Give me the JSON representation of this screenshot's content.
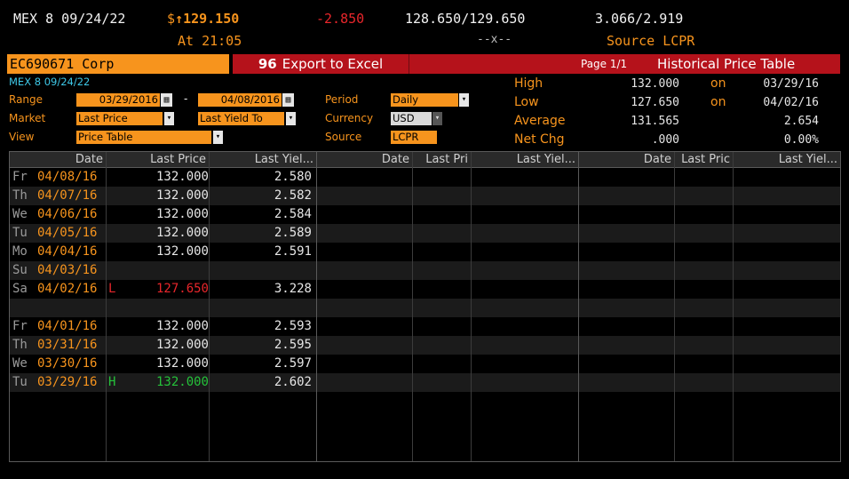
{
  "quote": {
    "ticker": "MEX 8 09/24/22",
    "currency": "$",
    "arrow": "↑",
    "last": "129.150",
    "change": "-2.850",
    "bid": "128.650",
    "ask": "129.650",
    "bid_yield": "3.066",
    "ask_yield": "2.919",
    "sep": "/",
    "time_label": "At 21:05",
    "size": "--x--",
    "source_label": "Source LCPR"
  },
  "toolbar": {
    "security": "EC690671 Corp",
    "export_icon": "96",
    "export_label": "Export to Excel",
    "page": "Page 1/1",
    "title": "Historical Price Table"
  },
  "controls": {
    "security_desc": "MEX 8 09/24/22",
    "range_label": "Range",
    "start_date": "03/29/2016",
    "dash": "-",
    "end_date": "04/08/2016",
    "period_label": "Period",
    "period_value": "Daily",
    "market_label": "Market",
    "market_value": "Last Price",
    "market2_value": "Last Yield To",
    "currency_label": "Currency",
    "currency_value": "USD",
    "view_label": "View",
    "view_value": "Price Table",
    "source_label": "Source",
    "source_value": "LCPR"
  },
  "stats": {
    "high_label": "High",
    "high_value": "132.000",
    "high_on": "on",
    "high_date": "03/29/16",
    "low_label": "Low",
    "low_value": "127.650",
    "low_on": "on",
    "low_date": "04/02/16",
    "avg_label": "Average",
    "avg_value": "131.565",
    "avg_yield": "2.654",
    "chg_label": "Net Chg",
    "chg_value": ".000",
    "chg_pct": "0.00%"
  },
  "table": {
    "headers": [
      "Date",
      "Last Price",
      "Last Yiel...",
      "Date",
      "Last Pri",
      "Last Yiel...",
      "Date",
      "Last Pric",
      "Last Yiel..."
    ],
    "rows": [
      {
        "day": "Fr",
        "date": "04/08/16",
        "flag": "",
        "price": "132.000",
        "yield": "2.580"
      },
      {
        "day": "Th",
        "date": "04/07/16",
        "flag": "",
        "price": "132.000",
        "yield": "2.582"
      },
      {
        "day": "We",
        "date": "04/06/16",
        "flag": "",
        "price": "132.000",
        "yield": "2.584"
      },
      {
        "day": "Tu",
        "date": "04/05/16",
        "flag": "",
        "price": "132.000",
        "yield": "2.589"
      },
      {
        "day": "Mo",
        "date": "04/04/16",
        "flag": "",
        "price": "132.000",
        "yield": "2.591"
      },
      {
        "day": "Su",
        "date": "04/03/16",
        "flag": "",
        "price": "",
        "yield": ""
      },
      {
        "day": "Sa",
        "date": "04/02/16",
        "flag": "L",
        "price": "127.650",
        "yield": "3.228"
      },
      {
        "day": "",
        "date": "",
        "flag": "",
        "price": "",
        "yield": ""
      },
      {
        "day": "Fr",
        "date": "04/01/16",
        "flag": "",
        "price": "132.000",
        "yield": "2.593"
      },
      {
        "day": "Th",
        "date": "03/31/16",
        "flag": "",
        "price": "132.000",
        "yield": "2.595"
      },
      {
        "day": "We",
        "date": "03/30/16",
        "flag": "",
        "price": "132.000",
        "yield": "2.597"
      },
      {
        "day": "Tu",
        "date": "03/29/16",
        "flag": "H",
        "price": "132.000",
        "yield": "2.602"
      }
    ]
  },
  "colors": {
    "accent": "#f7941d",
    "bar": "#b5121b",
    "low": "#e8262b",
    "high": "#25c23a"
  }
}
